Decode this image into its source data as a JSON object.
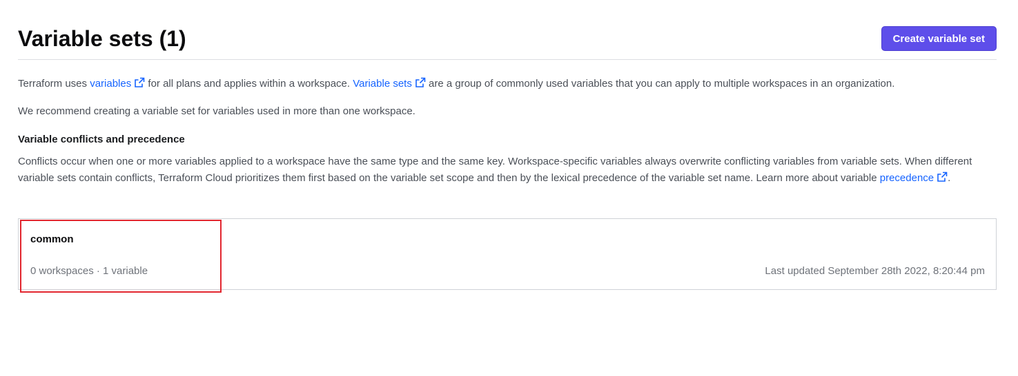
{
  "header": {
    "title": "Variable sets (1)",
    "create_button_label": "Create variable set"
  },
  "intro": {
    "p1_before": "Terraform uses ",
    "p1_link1": "variables",
    "p1_middle": " for all plans and applies within a workspace. ",
    "p1_link2": "Variable sets",
    "p1_after": " are a group of commonly used variables that you can apply to multiple workspaces in an organization.",
    "p2": "We recommend creating a variable set for variables used in more than one workspace."
  },
  "conflicts": {
    "heading": "Variable conflicts and precedence",
    "body_before": "Conflicts occur when one or more variables applied to a workspace have the same type and the same key. Workspace-specific variables always overwrite conflicting variables from variable sets. When different variable sets contain conflicts, Terraform Cloud prioritizes them first based on the variable set scope and then by the lexical precedence of the variable set name. Learn more about variable ",
    "body_link": "precedence",
    "body_after": "."
  },
  "variable_sets": [
    {
      "name": "common",
      "meta": "0 workspaces · 1 variable",
      "last_updated": "Last updated September 28th 2022, 8:20:44 pm"
    }
  ],
  "colors": {
    "primary_button": "#5e4eea",
    "link": "#1563ff",
    "highlight": "#e2262f"
  },
  "icons": {
    "external_link": "external-link-icon"
  }
}
